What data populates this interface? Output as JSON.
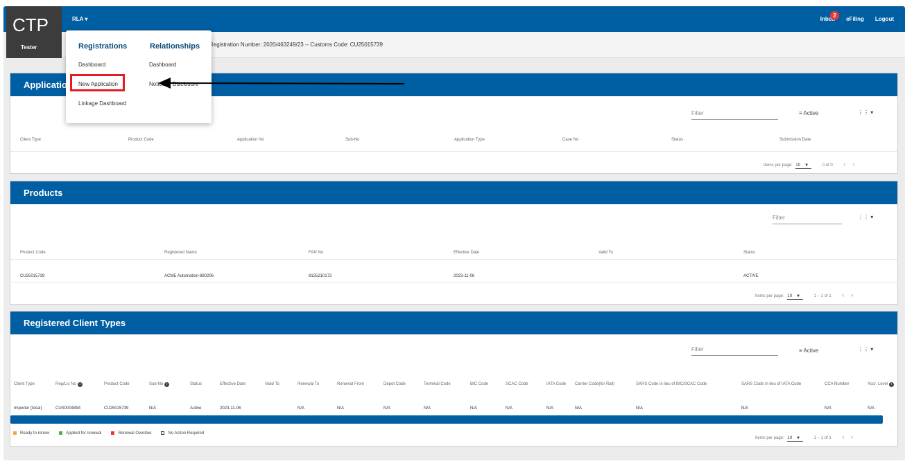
{
  "app": {
    "logo": "CTP",
    "user": "Tester"
  },
  "nav": {
    "menu": "RLA",
    "inbox": "Inbox",
    "inbox_count": "2",
    "efiling": "eFiling",
    "logout": "Logout"
  },
  "info_bar": {
    "text": "Registration Number: 2020/463249/23 -- Customs Code: CU25015739"
  },
  "dropdown": {
    "registrations": {
      "title": "Registrations",
      "items": [
        "Dashboard",
        "New Application",
        "Linkage Dashboard"
      ]
    },
    "relationships": {
      "title": "Relationships",
      "items": [
        "Dashboard",
        "Notice of Disclosure"
      ]
    }
  },
  "applications": {
    "title": "Applications",
    "filter_placeholder": "Filter",
    "status_filter": "Active",
    "columns": [
      "Client Type",
      "Product Code",
      "Application No",
      "Sub-No",
      "Application Type",
      "Case No",
      "Status",
      "Submission Date"
    ],
    "pager": {
      "label": "Items per page:",
      "size": "10",
      "range": "0 of 0"
    }
  },
  "products": {
    "title": "Products",
    "filter_placeholder": "Filter",
    "columns": [
      "Product Code",
      "Registered Name",
      "FAN No",
      "Effective Date",
      "Valid To",
      "Status"
    ],
    "rows": [
      [
        "CU25015739",
        "ACME Automation-880206",
        "8125210172",
        "2023-11-06",
        "",
        "ACTIVE"
      ]
    ],
    "pager": {
      "label": "Items per page:",
      "size": "10",
      "range": "1 – 1 of 1"
    }
  },
  "client_types": {
    "title": "Registered Client Types",
    "filter_placeholder": "Filter",
    "status_filter": "Active",
    "columns": [
      "Client Type",
      "Reg/Lic No",
      "Product Code",
      "Sub-No",
      "Status",
      "Effective Date",
      "Valid To",
      "Renewal To",
      "Renewal From",
      "Depot Code",
      "Terminal Code",
      "BIC Code",
      "SCAC Code",
      "IATA Code",
      "Carrier Code(for Rail)",
      "SARS Code in lieu of BIC/SCAC Code",
      "SARS Code in lieu of IATA Code",
      "CCA Number",
      "Accr. Level"
    ],
    "rows": [
      [
        "Importer (local)",
        "CUS0004894",
        "CU25015739",
        "N/A",
        "Active",
        "2023-11-06",
        "",
        "N/A",
        "N/A",
        "N/A",
        "N/A",
        "N/A",
        "N/A",
        "N/A",
        "N/A",
        "N/A",
        "N/A",
        "N/A",
        "N/A"
      ]
    ],
    "legend": [
      {
        "label": "Ready to renew",
        "color": "#f4a742"
      },
      {
        "label": "Applied for renewal",
        "color": "#4caf50"
      },
      {
        "label": "Renewal Overdue",
        "color": "#e53935"
      },
      {
        "label": "No Action Required",
        "color": "#ffffff"
      }
    ],
    "pager": {
      "label": "Items per page:",
      "size": "10",
      "range": "1 – 1 of 1"
    }
  },
  "colors": {
    "brand": "#005ea2",
    "highlight": "#e31b23"
  }
}
